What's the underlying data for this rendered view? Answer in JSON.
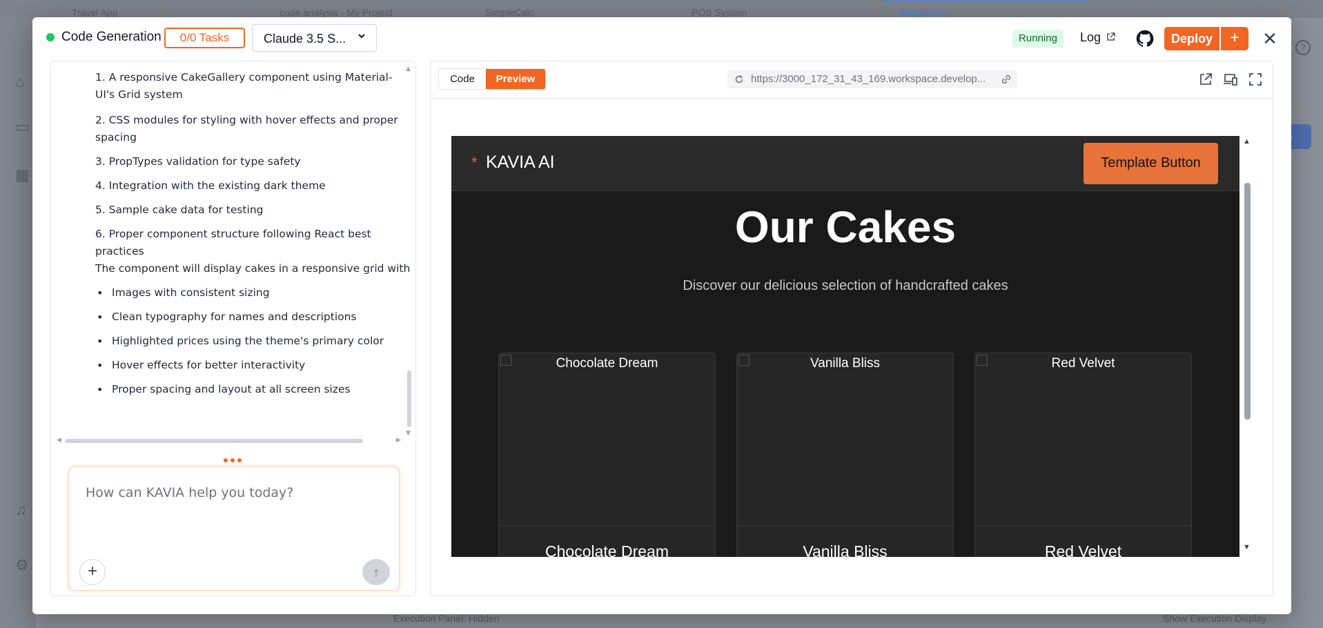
{
  "background": {
    "tabs": [
      "Travel App",
      "code analysis - My Project",
      "SimpleCalc",
      "POS System",
      "SimpleCalc"
    ],
    "bottom_left": "Execution Panel: Hidden",
    "bottom_right": "Show Execution Display"
  },
  "header": {
    "title": "Code Generation",
    "tasks_label": "0/0 Tasks",
    "model_label": "Claude 3.5 S...",
    "status_badge": "Running",
    "log_label": "Log",
    "deploy_label": "Deploy",
    "plus_label": "+",
    "close_label": "✕"
  },
  "chat": {
    "numbered_items": [
      "1. A responsive CakeGallery component using Material-UI's Grid system",
      "2. CSS modules for styling with hover effects and proper spacing",
      "3. PropTypes validation for type safety",
      "4. Integration with the existing dark theme",
      "5. Sample cake data for testing",
      "6. Proper component structure following React best practices"
    ],
    "summary_line": "The component will display cakes in a responsive grid with",
    "bullets": [
      "Images with consistent sizing",
      "Clean typography for names and descriptions",
      "Highlighted prices using the theme's primary color",
      "Hover effects for better interactivity",
      "Proper spacing and layout at all screen sizes"
    ],
    "input_placeholder": "How can KAVIA help you today?",
    "attach_label": "+",
    "send_label": "↑"
  },
  "preview": {
    "tab_code": "Code",
    "tab_preview": "Preview",
    "url": "https://3000_172_31_43_169.workspace.develop...",
    "site": {
      "logo_mark": "*",
      "logo_text": "KAVIA AI",
      "nav_button": "Template Button",
      "hero_title": "Our Cakes",
      "hero_subtitle": "Discover our delicious selection of handcrafted cakes",
      "cards": [
        {
          "alt": "Chocolate Dream",
          "name": "Chocolate Dream"
        },
        {
          "alt": "Vanilla Bliss",
          "name": "Vanilla Bliss"
        },
        {
          "alt": "Red Velvet",
          "name": "Red Velvet"
        }
      ]
    }
  },
  "colors": {
    "accent": "#f26522",
    "running_bg": "#dcfce7",
    "running_text": "#166534",
    "site_bg": "#1a1a1a"
  }
}
